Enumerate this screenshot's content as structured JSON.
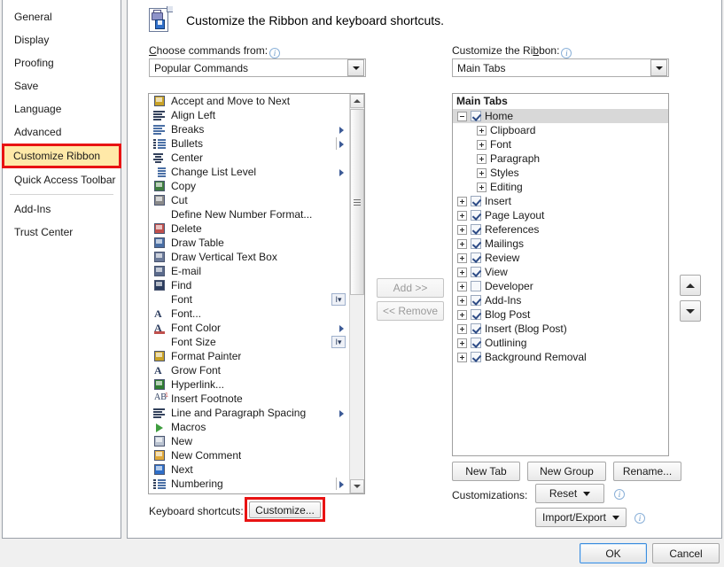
{
  "sidebar": {
    "items": [
      {
        "label": "General",
        "selected": false
      },
      {
        "label": "Display",
        "selected": false
      },
      {
        "label": "Proofing",
        "selected": false
      },
      {
        "label": "Save",
        "selected": false
      },
      {
        "label": "Language",
        "selected": false
      },
      {
        "label": "Advanced",
        "selected": false
      },
      {
        "label": "Customize Ribbon",
        "selected": true
      },
      {
        "label": "Quick Access Toolbar",
        "selected": false
      },
      {
        "label": "Add-Ins",
        "selected": false
      },
      {
        "label": "Trust Center",
        "selected": false
      }
    ]
  },
  "header": {
    "title": "Customize the Ribbon and keyboard shortcuts.",
    "icon": "document-print-save-icon"
  },
  "left_pane": {
    "label": "Choose commands from:",
    "label_accel": "C",
    "info_icon": "info-icon",
    "combo_value": "Popular Commands",
    "commands": [
      {
        "label": "Accept and Move to Next",
        "icon": "accept-change-icon",
        "submenu": false
      },
      {
        "label": "Align Left",
        "icon": "align-left-icon",
        "submenu": false
      },
      {
        "label": "Breaks",
        "icon": "breaks-icon",
        "submenu": true
      },
      {
        "label": "Bullets",
        "icon": "bullets-icon",
        "submenu": true,
        "split": true
      },
      {
        "label": "Center",
        "icon": "align-center-icon",
        "submenu": false
      },
      {
        "label": "Change List Level",
        "icon": "change-list-level-icon",
        "submenu": true
      },
      {
        "label": "Copy",
        "icon": "copy-icon",
        "submenu": false
      },
      {
        "label": "Cut",
        "icon": "cut-icon",
        "submenu": false
      },
      {
        "label": "Define New Number Format...",
        "icon": "none",
        "submenu": false
      },
      {
        "label": "Delete",
        "icon": "delete-icon",
        "submenu": false
      },
      {
        "label": "Draw Table",
        "icon": "draw-table-icon",
        "submenu": false
      },
      {
        "label": "Draw Vertical Text Box",
        "icon": "draw-vertical-text-box-icon",
        "submenu": false
      },
      {
        "label": "E-mail",
        "icon": "email-icon",
        "submenu": false
      },
      {
        "label": "Find",
        "icon": "find-icon",
        "submenu": false
      },
      {
        "label": "Font",
        "icon": "none",
        "submenu": false,
        "ibeam": true
      },
      {
        "label": "Font...",
        "icon": "font-dialog-icon",
        "submenu": false
      },
      {
        "label": "Font Color",
        "icon": "font-color-icon",
        "submenu": true
      },
      {
        "label": "Font Size",
        "icon": "none",
        "submenu": false,
        "ibeam": true
      },
      {
        "label": "Format Painter",
        "icon": "format-painter-icon",
        "submenu": false
      },
      {
        "label": "Grow Font",
        "icon": "grow-font-icon",
        "submenu": false
      },
      {
        "label": "Hyperlink...",
        "icon": "hyperlink-icon",
        "submenu": false
      },
      {
        "label": "Insert Footnote",
        "icon": "insert-footnote-icon",
        "submenu": false
      },
      {
        "label": "Line and Paragraph Spacing",
        "icon": "line-spacing-icon",
        "submenu": true
      },
      {
        "label": "Macros",
        "icon": "macros-icon",
        "submenu": false
      },
      {
        "label": "New",
        "icon": "new-document-icon",
        "submenu": false
      },
      {
        "label": "New Comment",
        "icon": "new-comment-icon",
        "submenu": false
      },
      {
        "label": "Next",
        "icon": "next-icon",
        "submenu": false
      },
      {
        "label": "Numbering",
        "icon": "numbering-icon",
        "submenu": true,
        "split": true
      }
    ]
  },
  "transfer": {
    "add_label": "Add >>",
    "add_accel": "A",
    "add_enabled": false,
    "remove_label": "<< Remove",
    "remove_accel": "R",
    "remove_enabled": false
  },
  "right_pane": {
    "label": "Customize the Ribbon:",
    "label_accel": "b",
    "info_icon": "info-icon",
    "combo_value": "Main Tabs",
    "tree_header": "Main Tabs",
    "tree": [
      {
        "label": "Home",
        "level": 0,
        "expander": "minus",
        "checkbox": "checked",
        "selected": true
      },
      {
        "label": "Clipboard",
        "level": 1,
        "expander": "plus",
        "checkbox": "none",
        "selected": false
      },
      {
        "label": "Font",
        "level": 1,
        "expander": "plus",
        "checkbox": "none",
        "selected": false
      },
      {
        "label": "Paragraph",
        "level": 1,
        "expander": "plus",
        "checkbox": "none",
        "selected": false
      },
      {
        "label": "Styles",
        "level": 1,
        "expander": "plus",
        "checkbox": "none",
        "selected": false
      },
      {
        "label": "Editing",
        "level": 1,
        "expander": "plus",
        "checkbox": "none",
        "selected": false
      },
      {
        "label": "Insert",
        "level": 0,
        "expander": "plus",
        "checkbox": "checked",
        "selected": false
      },
      {
        "label": "Page Layout",
        "level": 0,
        "expander": "plus",
        "checkbox": "checked",
        "selected": false
      },
      {
        "label": "References",
        "level": 0,
        "expander": "plus",
        "checkbox": "checked",
        "selected": false
      },
      {
        "label": "Mailings",
        "level": 0,
        "expander": "plus",
        "checkbox": "checked",
        "selected": false
      },
      {
        "label": "Review",
        "level": 0,
        "expander": "plus",
        "checkbox": "checked",
        "selected": false
      },
      {
        "label": "View",
        "level": 0,
        "expander": "plus",
        "checkbox": "checked",
        "selected": false
      },
      {
        "label": "Developer",
        "level": 0,
        "expander": "plus",
        "checkbox": "unchecked",
        "selected": false
      },
      {
        "label": "Add-Ins",
        "level": 0,
        "expander": "plus",
        "checkbox": "checked",
        "selected": false
      },
      {
        "label": "Blog Post",
        "level": 0,
        "expander": "plus",
        "checkbox": "checked",
        "selected": false
      },
      {
        "label": "Insert (Blog Post)",
        "level": 0,
        "expander": "plus",
        "checkbox": "checked",
        "selected": false
      },
      {
        "label": "Outlining",
        "level": 0,
        "expander": "plus",
        "checkbox": "checked",
        "selected": false
      },
      {
        "label": "Background Removal",
        "level": 0,
        "expander": "plus",
        "checkbox": "checked",
        "selected": false
      }
    ],
    "new_tab_label": "New Tab",
    "new_group_label": "New Group",
    "rename_label": "Rename...",
    "customizations_label": "Customizations:",
    "reset_label": "Reset",
    "import_export_label": "Import/Export",
    "move_up_icon": "arrow-up-icon",
    "move_down_icon": "arrow-down-icon"
  },
  "keyboard": {
    "label": "Keyboard shortcuts:",
    "customize_label": "Customize...",
    "highlight_color": "#e81313"
  },
  "footer": {
    "ok_label": "OK",
    "cancel_label": "Cancel"
  }
}
